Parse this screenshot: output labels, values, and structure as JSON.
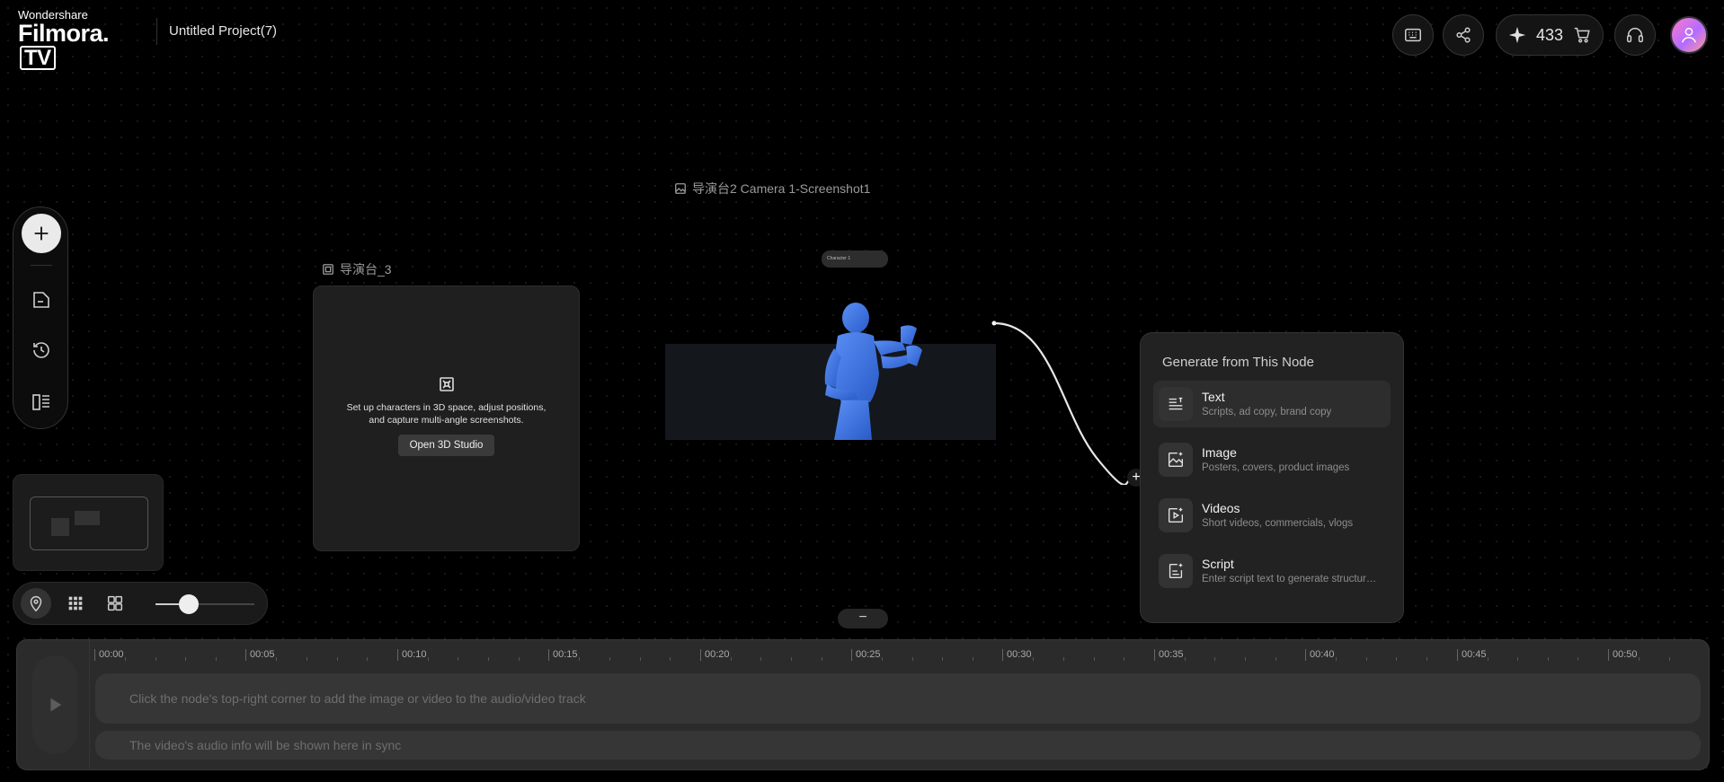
{
  "header": {
    "brand_top": "Wondershare",
    "brand_name": "Filmora.",
    "brand_tv": "TV",
    "project_title": "Untitled Project(7)",
    "credits": "433",
    "icons": [
      "keyboard-icon",
      "share-icon",
      "sparkle-icon",
      "cart-icon",
      "headset-icon",
      "avatar"
    ]
  },
  "canvas": {
    "node_3d_label": "导演台_3",
    "node_3d_desc": "Set up characters in 3D space, adjust positions, and capture multi-angle screenshots.",
    "node_3d_button": "Open 3D Studio",
    "node_screenshot_label": "导演台2 Camera 1-Screenshot1",
    "character_chip": "Character 1"
  },
  "generate_panel": {
    "title": "Generate from This Node",
    "items": [
      {
        "name": "Text",
        "sub": "Scripts, ad copy, brand copy",
        "icon": "text-lines-icon"
      },
      {
        "name": "Image",
        "sub": "Posters, covers, product images",
        "icon": "image-sparkle-icon"
      },
      {
        "name": "Videos",
        "sub": "Short videos, commercials, vlogs",
        "icon": "video-sparkle-icon"
      },
      {
        "name": "Script",
        "sub": "Enter script text to generate structured storyboards",
        "icon": "script-doc-icon"
      }
    ]
  },
  "timeline": {
    "ticks": [
      "00:00",
      "00:05",
      "00:10",
      "00:15",
      "00:20",
      "00:25",
      "00:30",
      "00:35",
      "00:40",
      "00:45",
      "00:50"
    ],
    "video_hint": "Click the node's top-right corner to add the image or video to the audio/video track",
    "audio_hint": "The video's audio info will be shown here in sync"
  },
  "zoom": {
    "slider_level": 0.3
  },
  "colors": {
    "accent_figure": "#3f79e8",
    "background": "#000000",
    "panel": "#222222"
  }
}
